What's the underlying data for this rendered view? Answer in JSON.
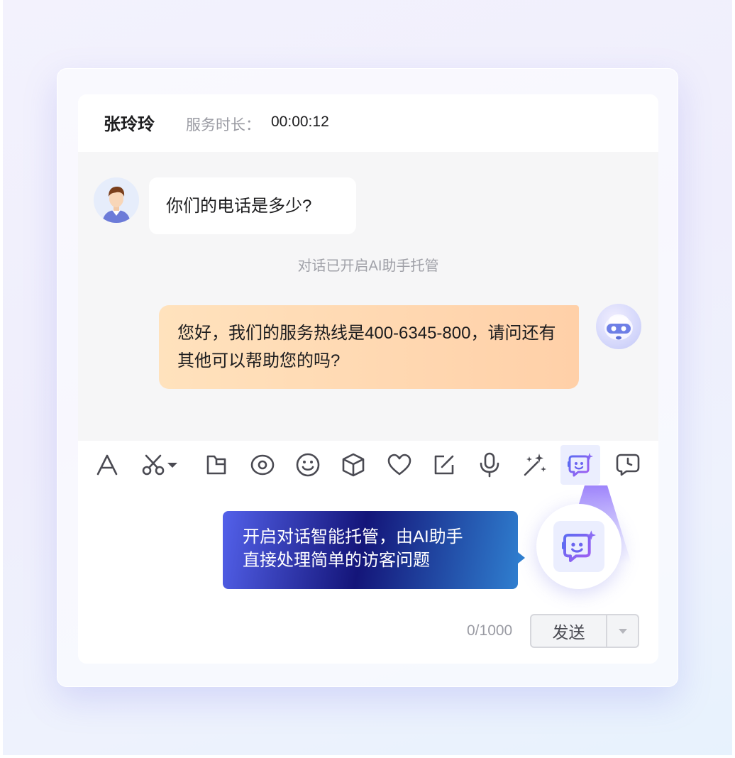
{
  "header": {
    "agent_name": "张玲玲",
    "duration_label": "服务时长：",
    "duration_value": "00:00:12"
  },
  "messages": [
    {
      "role": "visitor",
      "text": "你们的电话是多少?"
    },
    {
      "role": "system",
      "text": "对话已开启AI助手托管"
    },
    {
      "role": "bot",
      "text": "您好，我们的服务热线是400-6345-800，请问还有其他可以帮助您的吗?"
    }
  ],
  "toolbar": {
    "tools": [
      "font-icon",
      "scissors-icon",
      "file-icon",
      "eye-icon",
      "smiley-icon",
      "cube-icon",
      "heart-icon",
      "edit-icon",
      "microphone-icon",
      "magic-wand-icon",
      "ai-bot-icon",
      "clock-message-icon"
    ],
    "active_tool": "ai-bot-icon"
  },
  "tooltip": {
    "line1": "开启对话智能托管，由AI助手",
    "line2": "直接处理简单的访客问题"
  },
  "composer": {
    "char_count": "0/1000",
    "send_label": "发送"
  },
  "colors": {
    "accent": "#6b6ef0",
    "bot_bubble_start": "#ffe2bd",
    "bot_bubble_end": "#ffd0a8",
    "tooltip_start": "#5361ea",
    "tooltip_mid": "#141579",
    "tooltip_end": "#2f7ecf"
  }
}
